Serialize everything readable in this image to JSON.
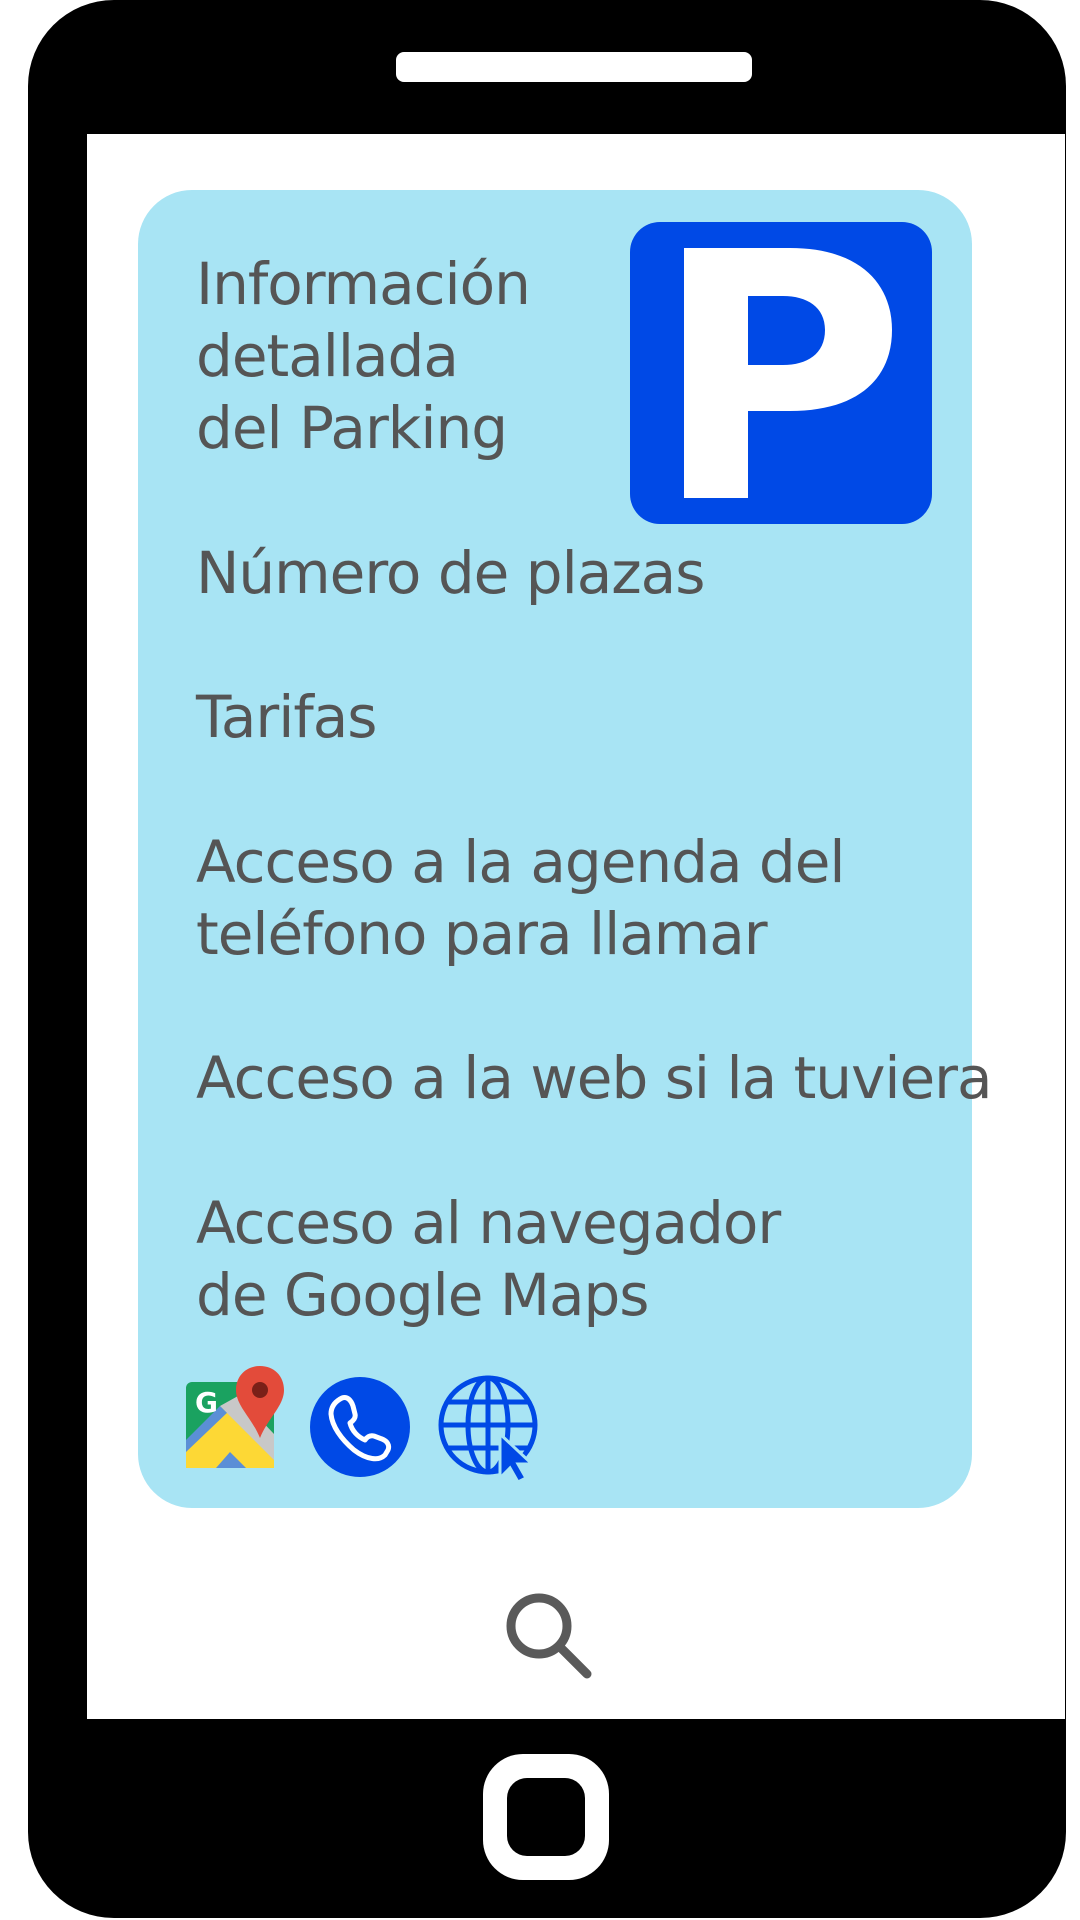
{
  "info_card": {
    "title_lines": [
      "Información",
      "detallada",
      "del Parking"
    ],
    "items": [
      [
        "Número de plazas"
      ],
      [
        "Tarifas"
      ],
      [
        "Acceso a la agenda del",
        "teléfono para llamar"
      ],
      [
        "Acceso a la web si la tuviera"
      ],
      [
        "Acceso al navegador",
        "de Google Maps"
      ]
    ],
    "parking_sign_letter": "P",
    "background_color": "#a8e4f4",
    "text_color": "#555555"
  },
  "sign_colors": {
    "blue": "#0049e6",
    "white": "#ffffff"
  },
  "bottom_icons": [
    "google-maps-icon",
    "phone-icon",
    "web-globe-icon"
  ],
  "footer_icon": "search-icon"
}
